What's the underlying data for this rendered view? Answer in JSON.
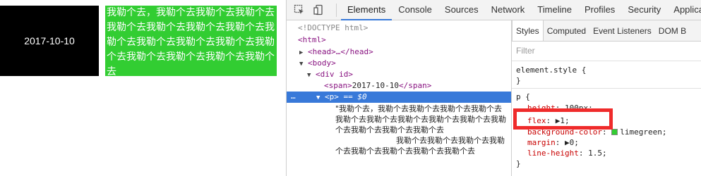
{
  "page": {
    "date": "2017-10-10",
    "paragraph": "我勒个去，我勒个去我勒个去我勒个去我勒个去我勒个去我勒个去我勒个去我勒个去我勒个去我勒个去我勒个去我勒个去我勒个去我勒个去我勒个去我勒个去"
  },
  "devtools": {
    "tabs": [
      "Elements",
      "Console",
      "Sources",
      "Network",
      "Timeline",
      "Profiles",
      "Security",
      "Applicat"
    ],
    "active_tab": "Elements",
    "dom": {
      "doctype": "<!DOCTYPE html>",
      "html": "<html>",
      "head": "<head>…</head>",
      "body": "<body>",
      "div": "<div id>",
      "span_open": "<span>",
      "span_text": "2017-10-10",
      "span_close": "</span>",
      "selected_p": "<p>",
      "selected_marker": "== $0",
      "selected_dots": "…",
      "text_node_lines": [
        "\"我勒个去，我勒个去我勒个去我勒个去我勒个去我勒个去我勒个去我勒个去我勒个去我勒个去我勒个去我勒个去我勒个去我勒个去",
        "我勒个去我勒个去我勒个去我勒个去我勒个去我勒个去我勒个去我勒个去"
      ]
    },
    "styles": {
      "sub_tabs": [
        "Styles",
        "Computed",
        "Event Listeners",
        "DOM B"
      ],
      "filter_placeholder": "Filter",
      "element_style": "element.style {",
      "element_style_close": "}",
      "selector": "p {",
      "rules": [
        {
          "prop": "height",
          "value": "100px;"
        },
        {
          "prop": "flex",
          "value": "▶1;"
        },
        {
          "prop": "background-color",
          "value": "limegreen;"
        },
        {
          "prop": "margin",
          "value": "▶0;"
        },
        {
          "prop": "line-height",
          "value": "1.5;"
        }
      ],
      "rule_close": "}",
      "swatch_color": "#32cd32"
    },
    "highlight_color": "#ef2b2b"
  }
}
